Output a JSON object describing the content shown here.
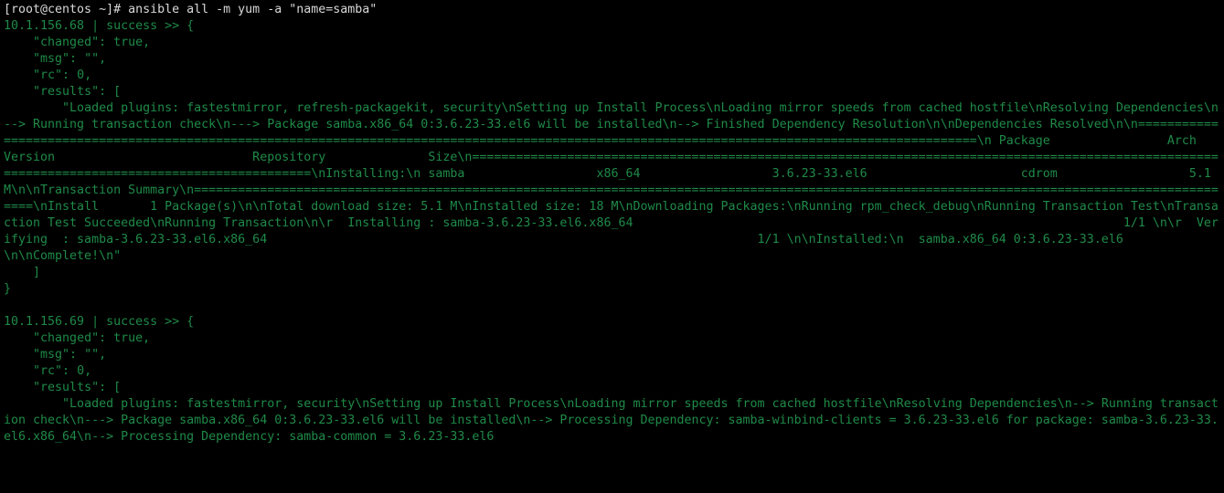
{
  "prompt_line": "[root@centos ~]# ansible all -m yum -a \"name=samba\"",
  "host1_header": "10.1.156.68 | success >> {",
  "host1_body": "    \"changed\": true,\n    \"msg\": \"\",\n    \"rc\": 0,\n    \"results\": [\n        \"Loaded plugins: fastestmirror, refresh-packagekit, security\\nSetting up Install Process\\nLoading mirror speeds from cached hostfile\\nResolving Dependencies\\n--> Running transaction check\\n---> Package samba.x86_64 0:3.6.23-33.el6 will be installed\\n--> Finished Dependency Resolution\\n\\nDependencies Resolved\\n\\n================================================================================================================================================\\n Package                Arch                    Version                           Repository              Size\\n================================================================================================================================================\\nInstalling:\\n samba                  x86_64                  3.6.23-33.el6                     cdrom                  5.1 M\\n\\nTransaction Summary\\n================================================================================================================================================\\nInstall       1 Package(s)\\n\\nTotal download size: 5.1 M\\nInstalled size: 18 M\\nDownloading Packages:\\nRunning rpm_check_debug\\nRunning Transaction Test\\nTransaction Test Succeeded\\nRunning Transaction\\n\\r  Installing : samba-3.6.23-33.el6.x86_64                                                                   1/1 \\n\\r  Verifying  : samba-3.6.23-33.el6.x86_64                                                                   1/1 \\n\\nInstalled:\\n  samba.x86_64 0:3.6.23-33.el6                                                                                   \\n\\nComplete!\\n\"\n    ]\n}\n",
  "host2_header": "10.1.156.69 | success >> {",
  "host2_body": "    \"changed\": true,\n    \"msg\": \"\",\n    \"rc\": 0,\n    \"results\": [\n        \"Loaded plugins: fastestmirror, security\\nSetting up Install Process\\nLoading mirror speeds from cached hostfile\\nResolving Dependencies\\n--> Running transaction check\\n---> Package samba.x86_64 0:3.6.23-33.el6 will be installed\\n--> Processing Dependency: samba-winbind-clients = 3.6.23-33.el6 for package: samba-3.6.23-33.el6.x86_64\\n--> Processing Dependency: samba-common = 3.6.23-33.el6"
}
